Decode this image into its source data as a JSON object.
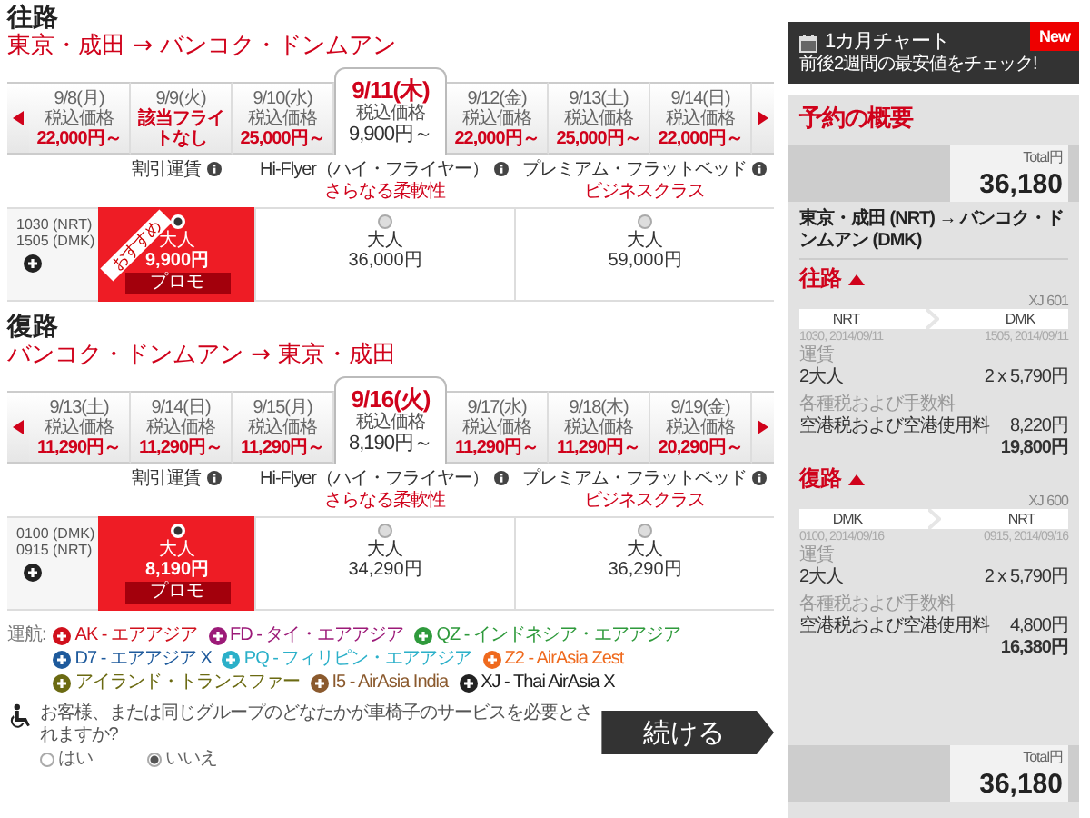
{
  "outbound": {
    "heading": "往路",
    "route": "東京・成田 → バンコク・ドンムアン",
    "dates": [
      {
        "date": "9/8(月)",
        "label": "税込価格",
        "price": "22,000円～",
        "selected": false
      },
      {
        "date": "9/9(火)",
        "note": "該当フライトなし",
        "selected": false
      },
      {
        "date": "9/10(水)",
        "label": "税込価格",
        "price": "25,000円～",
        "selected": false
      },
      {
        "date": "9/11(木)",
        "label": "税込価格",
        "price": "9,900円～",
        "selected": true
      },
      {
        "date": "9/12(金)",
        "label": "税込価格",
        "price": "22,000円～",
        "selected": false
      },
      {
        "date": "9/13(土)",
        "label": "税込価格",
        "price": "25,000円～",
        "selected": false
      },
      {
        "date": "9/14(日)",
        "label": "税込価格",
        "price": "22,000円～",
        "selected": false
      }
    ],
    "fare_headers": [
      {
        "title": "割引運賃"
      },
      {
        "title": "Hi-Flyer（ハイ・フライヤー）",
        "subtitle": "さらなる柔軟性"
      },
      {
        "title": "プレミアム・フラットベッド",
        "subtitle": "ビジネスクラス"
      }
    ],
    "flight": {
      "departure": "1030 (NRT)",
      "arrival": "1505 (DMK)"
    },
    "fares": [
      {
        "passenger": "大人",
        "price": "9,900円",
        "promo": "プロモ",
        "ribbon": "おすすめ",
        "selected": true
      },
      {
        "passenger": "大人",
        "price": "36,000円",
        "selected": false
      },
      {
        "passenger": "大人",
        "price": "59,000円",
        "selected": false
      }
    ]
  },
  "return": {
    "heading": "復路",
    "route": "バンコク・ドンムアン → 東京・成田",
    "dates": [
      {
        "date": "9/13(土)",
        "label": "税込価格",
        "price": "11,290円～",
        "selected": false
      },
      {
        "date": "9/14(日)",
        "label": "税込価格",
        "price": "11,290円～",
        "selected": false
      },
      {
        "date": "9/15(月)",
        "label": "税込価格",
        "price": "11,290円～",
        "selected": false
      },
      {
        "date": "9/16(火)",
        "label": "税込価格",
        "price": "8,190円～",
        "selected": true
      },
      {
        "date": "9/17(水)",
        "label": "税込価格",
        "price": "11,290円～",
        "selected": false
      },
      {
        "date": "9/18(木)",
        "label": "税込価格",
        "price": "11,290円～",
        "selected": false
      },
      {
        "date": "9/19(金)",
        "label": "税込価格",
        "price": "20,290円～",
        "selected": false
      }
    ],
    "fare_headers": [
      {
        "title": "割引運賃"
      },
      {
        "title": "Hi-Flyer（ハイ・フライヤー）",
        "subtitle": "さらなる柔軟性"
      },
      {
        "title": "プレミアム・フラットベッド",
        "subtitle": "ビジネスクラス"
      }
    ],
    "flight": {
      "departure": "0100 (DMK)",
      "arrival": "0915 (NRT)"
    },
    "fares": [
      {
        "passenger": "大人",
        "price": "8,190円",
        "promo": "プロモ",
        "selected": true
      },
      {
        "passenger": "大人",
        "price": "34,290円",
        "selected": false
      },
      {
        "passenger": "大人",
        "price": "36,290円",
        "selected": false
      }
    ]
  },
  "legend": {
    "label": "運航:",
    "airlines": [
      {
        "name": "AK - エアアジア",
        "color": "#d0101c"
      },
      {
        "name": "FD - タイ・エアアジア",
        "color": "#9c1a78"
      },
      {
        "name": "QZ - インドネシア・エアアジア",
        "color": "#2f9a3c"
      },
      {
        "name": "D7 - エアアジア X",
        "color": "#1e5a9c"
      },
      {
        "name": "PQ - フィリピン・エアアジア",
        "color": "#2bb0c9"
      },
      {
        "name": "Z2 - AirAsia Zest",
        "color": "#ef6a1e"
      },
      {
        "name": "アイランド・トランスファー",
        "color": "#6b6a12"
      },
      {
        "name": "I5 - AirAsia India",
        "color": "#8b5a2e"
      },
      {
        "name": "XJ - Thai AirAsia X",
        "color": "#222222"
      }
    ]
  },
  "wheelchair": {
    "question": "お客様、または同じグループのどなたかが車椅子のサービスを必要とされますか?",
    "options": [
      {
        "label": "はい",
        "selected": false
      },
      {
        "label": "いいえ",
        "selected": true
      }
    ]
  },
  "continue_button": "続ける",
  "sidebar": {
    "chart_banner": {
      "title": "1カ月チャート",
      "subtitle": "前後2週間の最安値をチェック!",
      "badge": "New"
    },
    "summary": {
      "title": "予約の概要",
      "total_top": {
        "label": "Total円",
        "amount": "36,180"
      },
      "route": "東京・成田 (NRT) → バンコク・ドンムアン (DMK)",
      "legs": [
        {
          "title": "往路",
          "flight_no": "XJ 601",
          "from": "NRT",
          "to": "DMK",
          "departure": "1030, 2014/09/11",
          "arrival": "1505, 2014/09/11",
          "fare_label": "運賃",
          "passengers": "2大人",
          "fare": "2 x 5,790円",
          "tax_label": "各種税および手数料",
          "tax_name": "空港税および空港使用料",
          "tax": "8,220円",
          "subtotal": "19,800円"
        },
        {
          "title": "復路",
          "flight_no": "XJ 600",
          "from": "DMK",
          "to": "NRT",
          "departure": "0100, 2014/09/16",
          "arrival": "0915, 2014/09/16",
          "fare_label": "運賃",
          "passengers": "2大人",
          "fare": "2 x 5,790円",
          "tax_label": "各種税および手数料",
          "tax_name": "空港税および空港使用料",
          "tax": "4,800円",
          "subtotal": "16,380円"
        }
      ],
      "total_bottom": {
        "label": "Total円",
        "amount": "36,180"
      }
    }
  }
}
